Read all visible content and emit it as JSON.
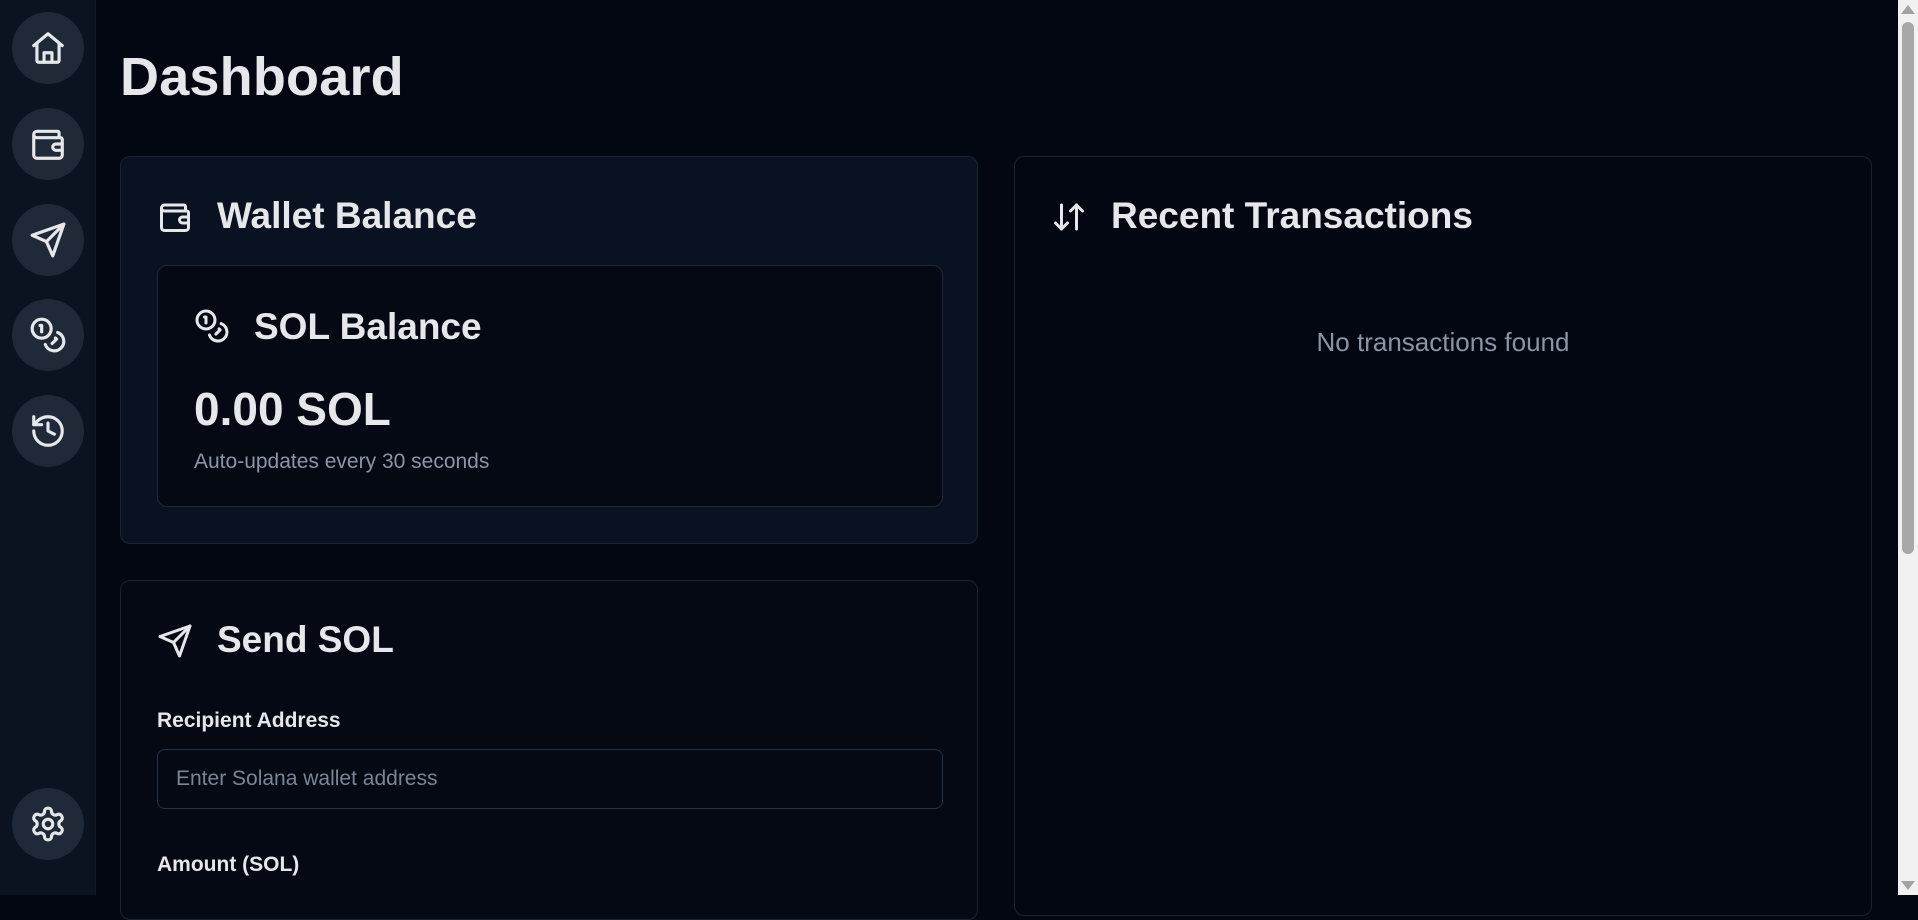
{
  "page": {
    "title": "Dashboard"
  },
  "sidebar": {
    "items": [
      {
        "name": "home",
        "icon": "home-icon"
      },
      {
        "name": "wallet",
        "icon": "wallet-icon"
      },
      {
        "name": "send",
        "icon": "send-icon"
      },
      {
        "name": "tokens",
        "icon": "coins-icon"
      },
      {
        "name": "history",
        "icon": "history-icon"
      }
    ],
    "settings": {
      "icon": "gear-icon"
    }
  },
  "wallet_balance": {
    "title": "Wallet Balance",
    "icon": "wallet-icon",
    "sol_card": {
      "title": "SOL Balance",
      "icon": "coins-icon",
      "value": "0.00 SOL",
      "note": "Auto-updates every 30 seconds"
    }
  },
  "send_sol": {
    "title": "Send SOL",
    "icon": "send-icon",
    "recipient_label": "Recipient Address",
    "recipient_placeholder": "Enter Solana wallet address",
    "recipient_value": "",
    "amount_label": "Amount (SOL)"
  },
  "transactions": {
    "title": "Recent Transactions",
    "icon": "arrow-up-down-icon",
    "empty_message": "No transactions found"
  },
  "colors": {
    "background": "#030712",
    "sidebar": "#0b1220",
    "card": "#0a1120",
    "button": "#1f2937",
    "text": "#e5e7eb",
    "muted": "#8b95a5"
  }
}
